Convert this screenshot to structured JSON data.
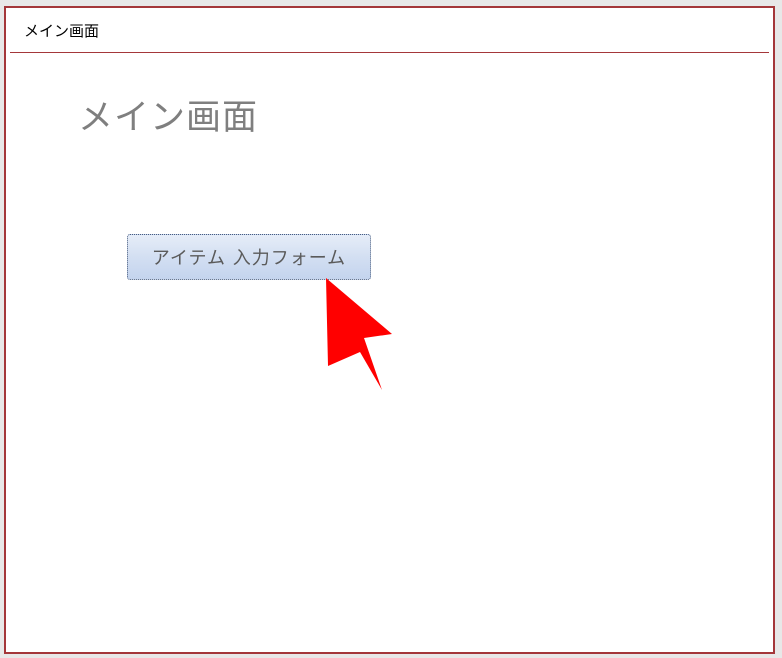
{
  "window": {
    "tab_title": "メイン画面"
  },
  "main": {
    "heading": "メイン画面",
    "form_button_label": "アイテム 入力フォーム"
  },
  "colors": {
    "frame_border": "#a4373a",
    "heading_text": "#7f7f7f",
    "button_gradient_top": "#e6edf8",
    "button_gradient_bottom": "#c4d4ee",
    "pointer_arrow": "#ff0000"
  },
  "icons": {
    "pointer": "red-arrow-pointer-icon"
  }
}
